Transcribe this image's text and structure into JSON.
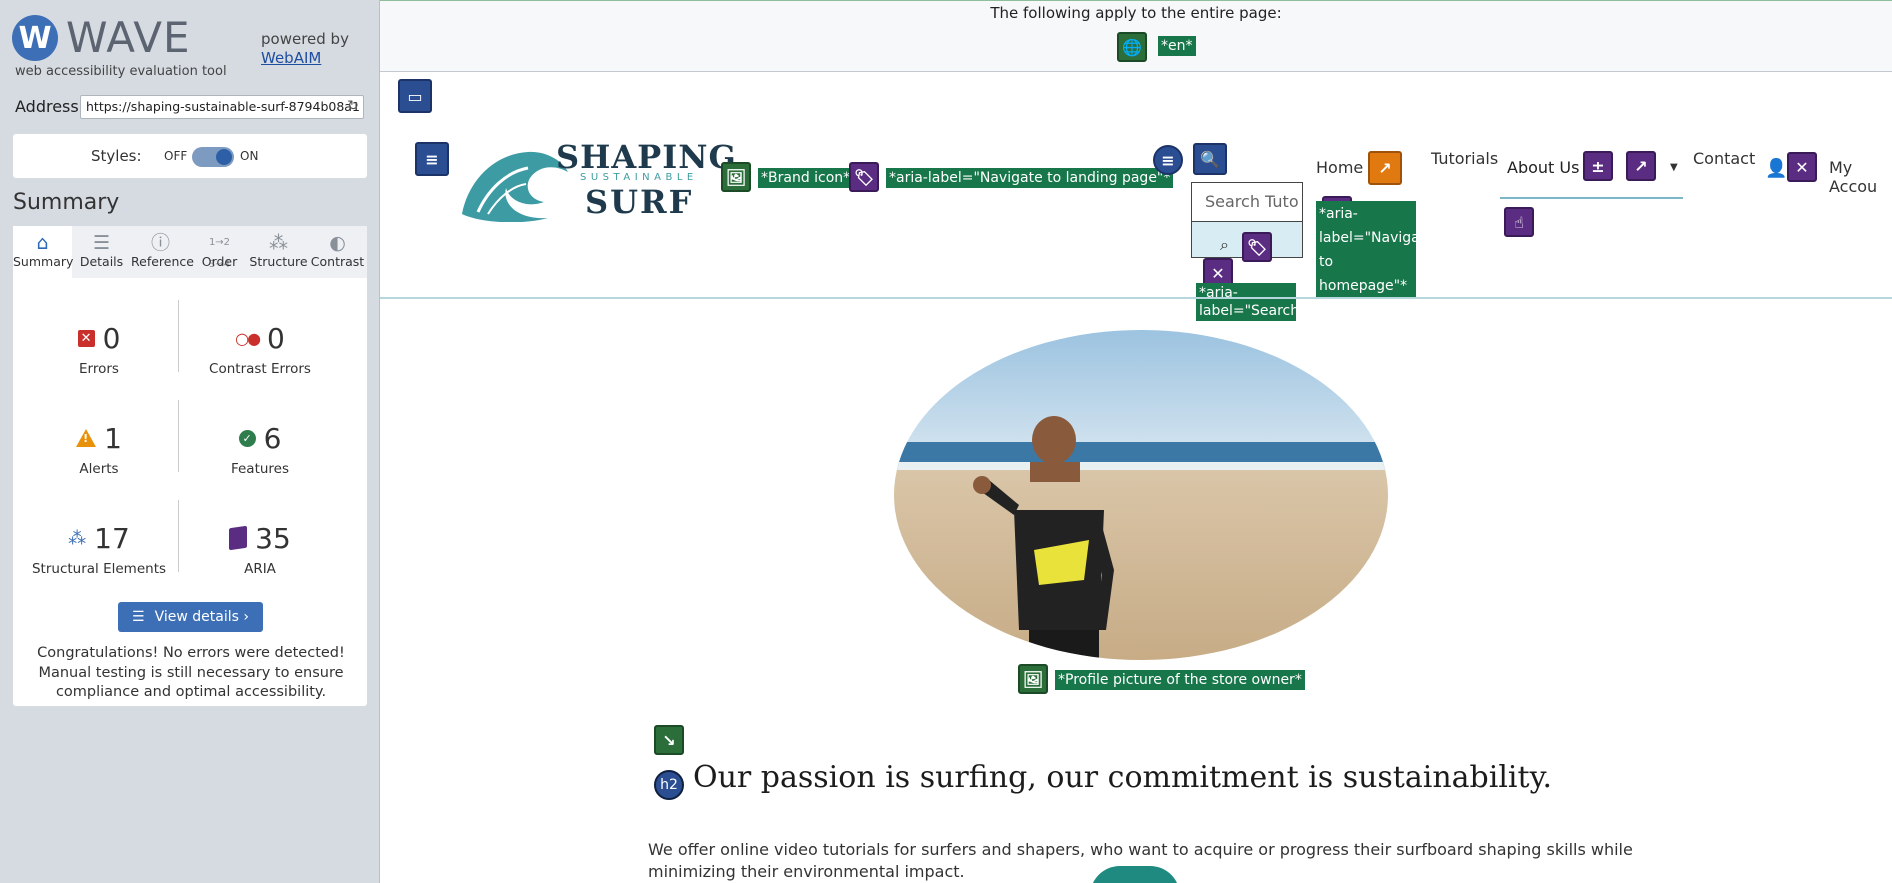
{
  "wave": {
    "logo_letter": "W",
    "logo_name": "WAVE",
    "logo_subtitle": "web accessibility evaluation tool",
    "powered_by": "powered by",
    "powered_link": "WebAIM",
    "address_label": "Address:",
    "address_value": "https://shaping-sustainable-surf-8794b08a1",
    "styles_label": "Styles:",
    "styles_off": "OFF",
    "styles_on": "ON",
    "summary_heading": "Summary",
    "tabs": [
      {
        "label": "Summary",
        "icon": "home-icon"
      },
      {
        "label": "Details",
        "icon": "list-icon"
      },
      {
        "label": "Reference",
        "icon": "info-icon"
      },
      {
        "label": "Order",
        "icon": "order-icon"
      },
      {
        "label": "Structure",
        "icon": "structure-icon"
      },
      {
        "label": "Contrast",
        "icon": "contrast-icon"
      }
    ],
    "stats": {
      "errors": {
        "count": "0",
        "label": "Errors"
      },
      "contrast_errors": {
        "count": "0",
        "label": "Contrast Errors"
      },
      "alerts": {
        "count": "1",
        "label": "Alerts"
      },
      "features": {
        "count": "6",
        "label": "Features"
      },
      "structural": {
        "count": "17",
        "label": "Structural Elements"
      },
      "aria": {
        "count": "35",
        "label": "ARIA"
      }
    },
    "view_details": "View details ›",
    "congrats": "Congratulations! No errors were detected! Manual testing is still necessary to ensure compliance and optimal accessibility."
  },
  "page": {
    "apply_text": "The following apply to the entire page:",
    "lang_tag": "*en*",
    "brand_line1": "SHAPING",
    "brand_line2": "SUSTAINABLE",
    "brand_line3": "SURF",
    "tag_brand_icon": "*Brand icon*",
    "tag_nav_landing": "*aria-label=\"Navigate to landing page\"*",
    "search_placeholder": "Search Tuto",
    "search_btn_icon": "🔍",
    "tag_nav_home": "*aria-label=\"Navigate to homepage\"*",
    "tag_search": "*aria-label=\"Search\"*",
    "nav": {
      "home": "Home",
      "tutorials": "Tutorials",
      "about": "About Us",
      "contact": "Contact",
      "account": "My Accou"
    },
    "tag_profile": "*Profile picture of the store owner*",
    "h2_badge": "h2",
    "heading": "Our passion is surfing, our commitment is sustainability.",
    "paragraph": "We offer online video tutorials for surfers and shapers, who want to acquire or progress their surfboard shaping skills while minimizing their environmental impact."
  },
  "colors": {
    "wave_blue": "#3d6fb6",
    "feature_green": "#2b6e3a",
    "aria_purple": "#5a2d82",
    "alert_orange": "#e07a10",
    "error_red": "#c9302c"
  }
}
